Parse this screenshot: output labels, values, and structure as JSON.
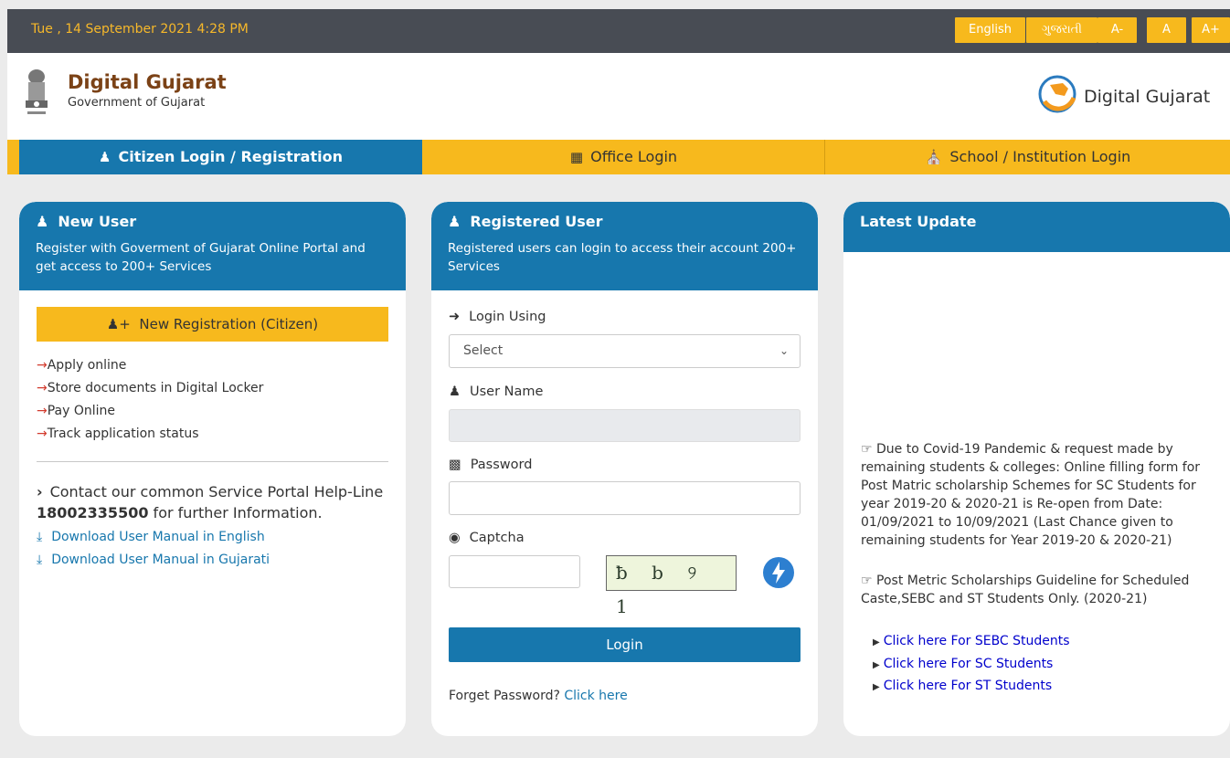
{
  "topbar": {
    "datetime": "Tue , 14 September 2021 4:28 PM",
    "buttons": [
      "English",
      "ગુજરાતી",
      "A-",
      "A",
      "A+"
    ]
  },
  "header": {
    "title": "Digital Gujarat",
    "subtitle": "Government of Gujarat",
    "logo_text": "Digital Gujarat"
  },
  "tabs": [
    {
      "label": "Citizen Login / Registration",
      "icon": "user-icon"
    },
    {
      "label": "Office Login",
      "icon": "building-icon"
    },
    {
      "label": "School / Institution Login",
      "icon": "institution-icon"
    }
  ],
  "new_user": {
    "title": "New User",
    "description": "Register with Goverment of Gujarat Online Portal and get access to 200+ Services",
    "register_button": "New Registration (Citizen)",
    "features": [
      "Apply online",
      "Store documents in Digital Locker",
      "Pay Online",
      "Track application status"
    ],
    "contact_pre": "Contact our common Service Portal Help-Line ",
    "helpline": "18002335500",
    "contact_post": " for further Information.",
    "downloads": [
      "Download User Manual in English",
      "Download User Manual in Gujarati"
    ]
  },
  "registered_user": {
    "title": "Registered User",
    "description": "Registered users can login to access their account 200+ Services",
    "login_using_label": "Login Using",
    "login_using_value": "Select",
    "username_label": "User Name",
    "password_label": "Password",
    "captcha_label": "Captcha",
    "captcha_text": "ƀ b ୨ 1",
    "login_button": "Login",
    "forgot_text": "Forget Password? ",
    "forgot_link": "Click here"
  },
  "latest_update": {
    "title": "Latest Update",
    "news": [
      "Due to Covid-19 Pandemic & request made by remaining students & colleges: Online filling form for Post Matric scholarship Schemes for SC Students for year 2019-20 & 2020-21 is Re-open from Date: 01/09/2021 to 10/09/2021 (Last Chance given to remaining students for Year 2019-20 & 2020-21)",
      "Post Metric Scholarships Guideline for Scheduled Caste,SEBC and ST Students Only. (2020-21)"
    ],
    "links": [
      "Click here For SEBC Students",
      "Click here For SC Students",
      "Click here For ST Students"
    ]
  },
  "colors": {
    "primary": "#1777ad",
    "accent": "#f7b91d",
    "topbar": "#484c54",
    "title_brown": "#7b4216"
  }
}
